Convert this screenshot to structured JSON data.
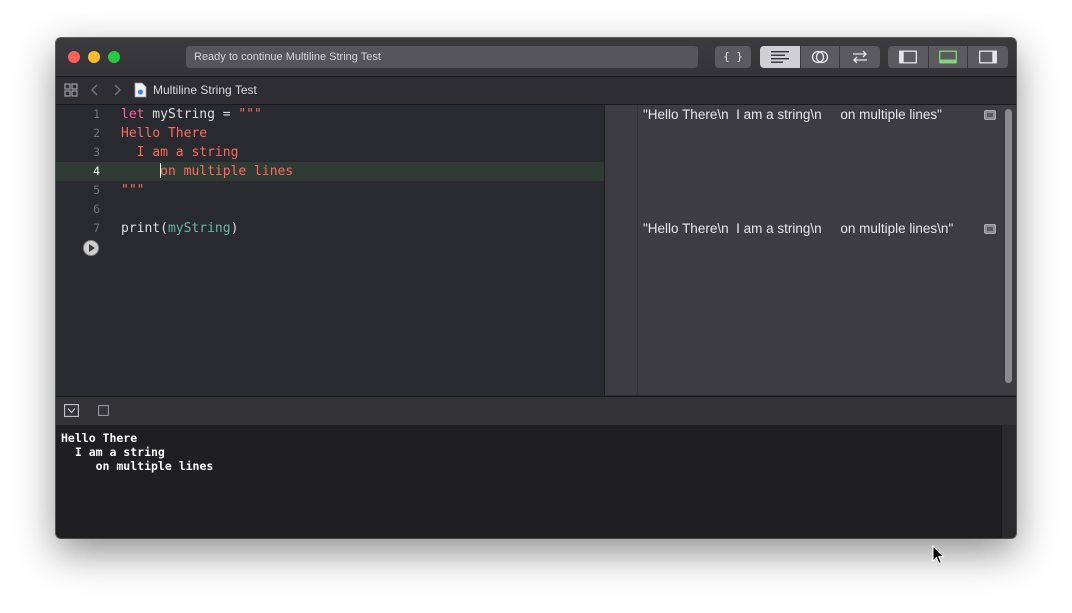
{
  "window": {
    "status_text": "Ready to continue Multiline String Test",
    "braces_label": "{ }"
  },
  "jumpbar": {
    "file_name": "Multiline String Test"
  },
  "editor": {
    "current_line": 4,
    "lines": [
      {
        "number": "1",
        "tokens": [
          [
            "kw",
            "let"
          ],
          [
            "plain",
            " myString = "
          ],
          [
            "str",
            "\"\"\""
          ]
        ]
      },
      {
        "number": "2",
        "tokens": [
          [
            "str",
            "Hello There"
          ]
        ]
      },
      {
        "number": "3",
        "tokens": [
          [
            "str",
            "  I am a string"
          ]
        ]
      },
      {
        "number": "4",
        "tokens": [
          [
            "str",
            "on multiple lines"
          ]
        ],
        "indent": "     "
      },
      {
        "number": "5",
        "tokens": [
          [
            "str",
            "\"\"\""
          ]
        ]
      },
      {
        "number": "6",
        "tokens": []
      },
      {
        "number": "7",
        "tokens": [
          [
            "plain",
            "print("
          ],
          [
            "fn",
            "myString"
          ],
          [
            "plain",
            ")"
          ]
        ]
      }
    ]
  },
  "results": [
    {
      "line": 1,
      "text": "\"Hello There\\n  I am a string\\n     on multiple lines\""
    },
    {
      "line": 7,
      "text": "\"Hello There\\n  I am a string\\n     on multiple lines\\n\""
    }
  ],
  "console": {
    "lines": [
      "Hello There",
      "  I am a string",
      "     on multiple lines"
    ]
  },
  "colors": {
    "keyword": "#fc5fa3",
    "string": "#fc6a5d",
    "identifier": "#67b7a4",
    "current_line": "#2f3b34",
    "editor_bg": "#292a30"
  }
}
